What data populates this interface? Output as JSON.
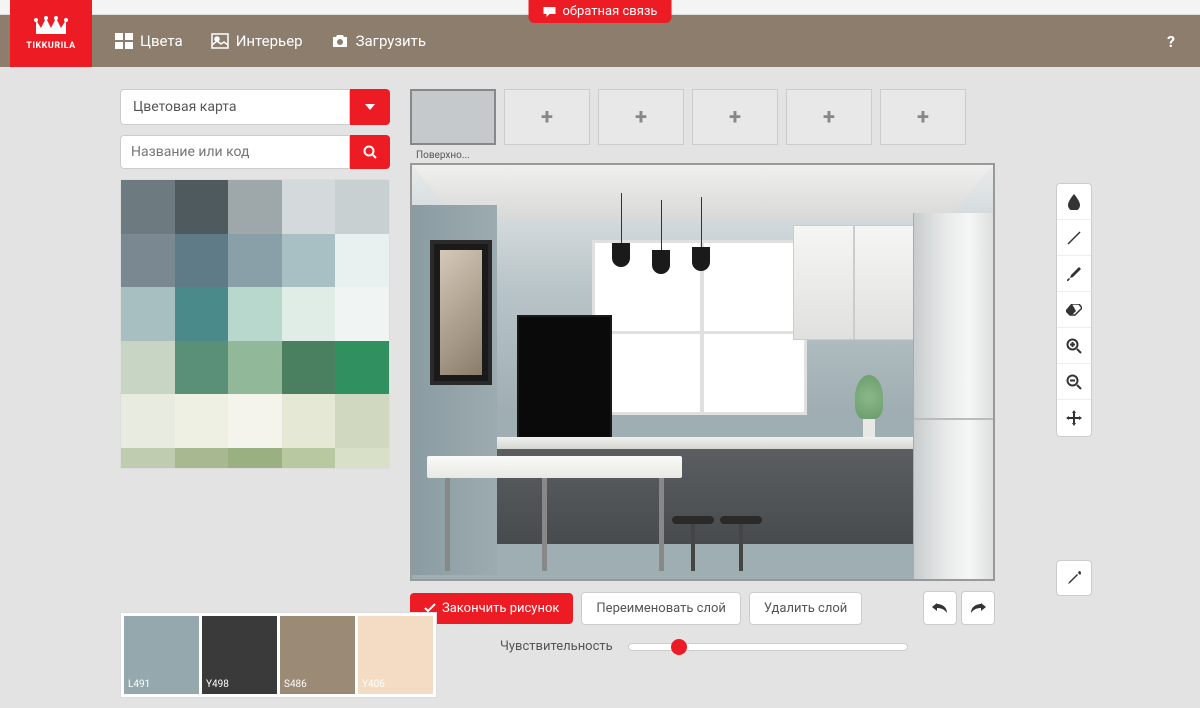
{
  "feedback": {
    "label": "обратная связь"
  },
  "brand": "TIKKURILA",
  "nav": {
    "colors": "Цвета",
    "interior": "Интерьер",
    "upload": "Загрузить"
  },
  "colorMap": {
    "dropdown": "Цветовая карта",
    "searchPlaceholder": "Название или код"
  },
  "swatches": [
    "#6d7a80",
    "#4f5a5f",
    "#9ea8ab",
    "#d4dadb",
    "#c8d0d2",
    "#7a8891",
    "#5f7b88",
    "#8aa0a8",
    "#a8c0c4",
    "#e8f0f0",
    "#a8bfc2",
    "#4a8a8a",
    "#b8d8ce",
    "#e0ece6",
    "#f0f4f2",
    "#c8d4c4",
    "#5a9078",
    "#92b89a",
    "#4a8060",
    "#309060",
    "#e8ece0",
    "#eef0e4",
    "#f4f4ec",
    "#e4e8d4",
    "#d0d8c0",
    "#c0ccb0",
    "#a8b890",
    "#9ab080",
    "#b8c8a0",
    "#d8e0c8"
  ],
  "surfaceTab": {
    "label": "Поверхно..."
  },
  "actions": {
    "finish": "Закончить рисунок",
    "rename": "Переименовать слой",
    "delete": "Удалить слой"
  },
  "sensitivity": {
    "label": "Чувствительность"
  },
  "selectedColors": [
    {
      "code": "L491",
      "hex": "#94a8ae"
    },
    {
      "code": "Y498",
      "hex": "#3a3a3a"
    },
    {
      "code": "S486",
      "hex": "#9a8a76"
    },
    {
      "code": "Y406",
      "hex": "#f4dcc4"
    }
  ],
  "tools": [
    "fill",
    "line",
    "brush",
    "eraser",
    "zoom-in",
    "zoom-out",
    "move"
  ],
  "eyedropper": "eyedropper"
}
